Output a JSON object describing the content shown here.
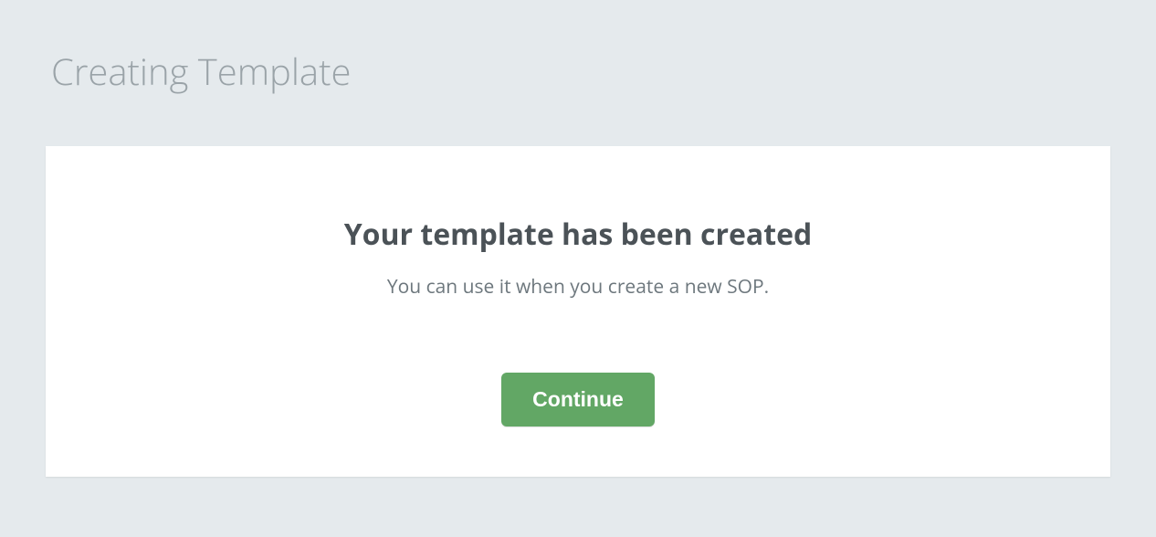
{
  "page": {
    "title": "Creating Template"
  },
  "card": {
    "heading": "Your template has been created",
    "subtext": "You can use it when you create a new SOP.",
    "continue_label": "Continue"
  }
}
